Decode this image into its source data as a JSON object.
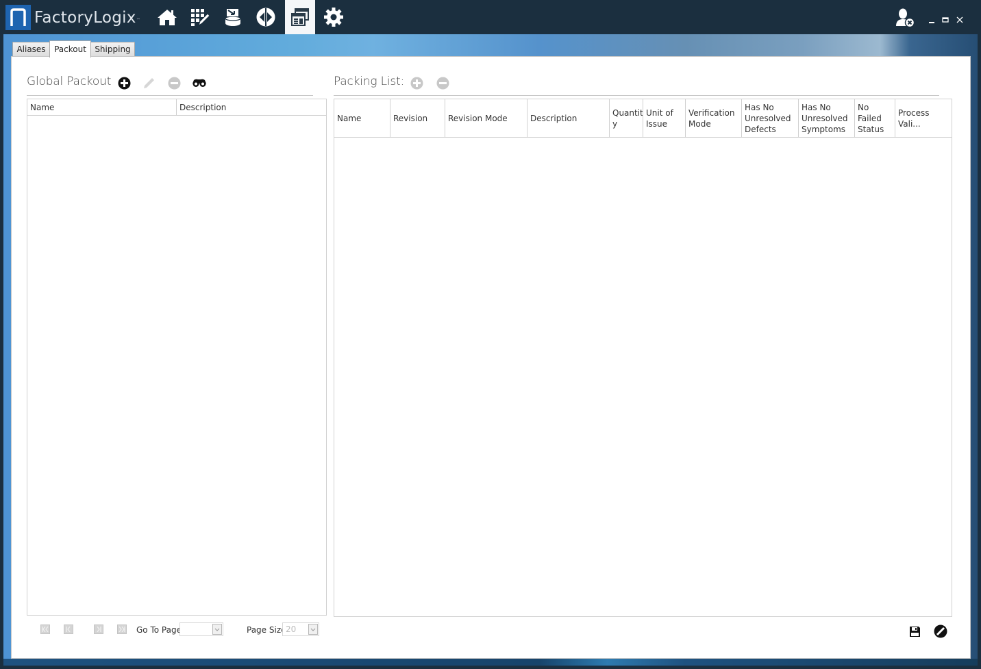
{
  "app": {
    "brand_name": "FactoryLogix",
    "brand_trademark": "™",
    "nav_icons": [
      {
        "name": "home-icon",
        "label": "Home"
      },
      {
        "name": "grid-edit-icon",
        "label": "Engineering"
      },
      {
        "name": "database-import-icon",
        "label": "Data Import"
      },
      {
        "name": "routing-icon",
        "label": "Routing"
      },
      {
        "name": "windows-icon",
        "label": "Windows",
        "active": true
      },
      {
        "name": "gear-icon",
        "label": "Settings"
      }
    ],
    "window_controls": {
      "user": "user-logout-icon",
      "minimize": "minimize-icon",
      "maximize": "maximize-icon",
      "close": "close-icon"
    }
  },
  "tabs": [
    {
      "label": "Aliases",
      "active": false
    },
    {
      "label": "Packout",
      "active": true
    },
    {
      "label": "Shipping",
      "active": false
    }
  ],
  "global_packout": {
    "title": "Global Packout",
    "toolbar": {
      "add": "add-icon",
      "edit": "edit-icon",
      "remove": "remove-icon",
      "find": "binoculars-icon"
    },
    "columns": [
      "Name",
      "Description"
    ],
    "rows": [],
    "pager": {
      "go_to_page_label": "Go To Page",
      "go_to_page_value": "",
      "page_size_label": "Page Size",
      "page_size_value": "20"
    }
  },
  "packing_list": {
    "title": "Packing List:",
    "toolbar": {
      "add": "add-icon",
      "remove": "remove-icon"
    },
    "columns": [
      "Name",
      "Revision",
      "Revision Mode",
      "Description",
      "Quantit\ny",
      "Unit of\nIssue",
      "Verification\nMode",
      "Has No\nUnresolved\nDefects",
      "Has No\nUnresolved\nSymptoms",
      "No\nFailed\nStatus",
      "Process Vali..."
    ],
    "rows": []
  },
  "footer": {
    "save": "save-icon",
    "cancel": "cancel-icon"
  },
  "colors": {
    "topbar": "#1b2f3f",
    "logo_blue": "#1e64b0",
    "active_nav_bg": "#f5f6f8",
    "disabled_icon": "#c8c8c8"
  }
}
